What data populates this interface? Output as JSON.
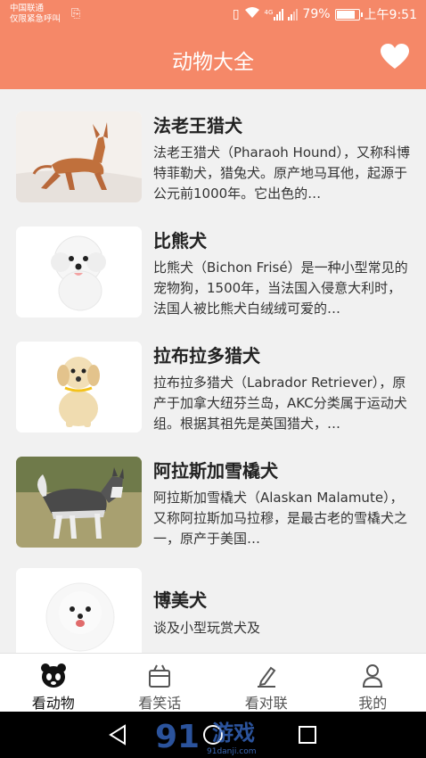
{
  "status_bar": {
    "carrier_line1": "中国联通",
    "carrier_line2": "仅限紧急呼叫",
    "battery_percent": "79%",
    "battery_level": 0.79,
    "time": "上午9:51",
    "network": "4G"
  },
  "header": {
    "title": "动物大全",
    "favorite_icon": "heart-icon"
  },
  "animals": [
    {
      "name": "法老王猎犬",
      "desc": "法老王猎犬（Pharaoh Hound），又称科博特菲勒犬，猎兔犬。原产地马耳他，起源于公元前1000年。它出色的…"
    },
    {
      "name": "比熊犬",
      "desc": "比熊犬（Bichon Frisé）是一种小型常见的宠物狗，1500年，当法国入侵意大利时，法国人被比熊犬白绒绒可爱的…"
    },
    {
      "name": "拉布拉多猎犬",
      "desc": "拉布拉多猎犬（Labrador Retriever），原产于加拿大纽芬兰岛，AKC分类属于运动犬组。根据其祖先是英国猎犬，…"
    },
    {
      "name": "阿拉斯加雪橇犬",
      "desc": "阿拉斯加雪橇犬（Alaskan Malamute），又称阿拉斯加马拉穆，是最古老的雪橇犬之一，原产于美国…"
    },
    {
      "name": "博美犬",
      "desc": "谈及小型玩赏犬及"
    }
  ],
  "tabs": [
    {
      "label": "看动物",
      "icon": "panda-icon",
      "active": true
    },
    {
      "label": "看笑话",
      "icon": "basket-icon",
      "active": false
    },
    {
      "label": "看对联",
      "icon": "pen-icon",
      "active": false
    },
    {
      "label": "我的",
      "icon": "person-icon",
      "active": false
    }
  ],
  "watermark": {
    "brand": "游戏",
    "number": "91",
    "site": "91danji.com"
  },
  "colors": {
    "header_bg": "#f58868",
    "background": "#f1f1f1",
    "tab_bg": "#ffffff"
  }
}
